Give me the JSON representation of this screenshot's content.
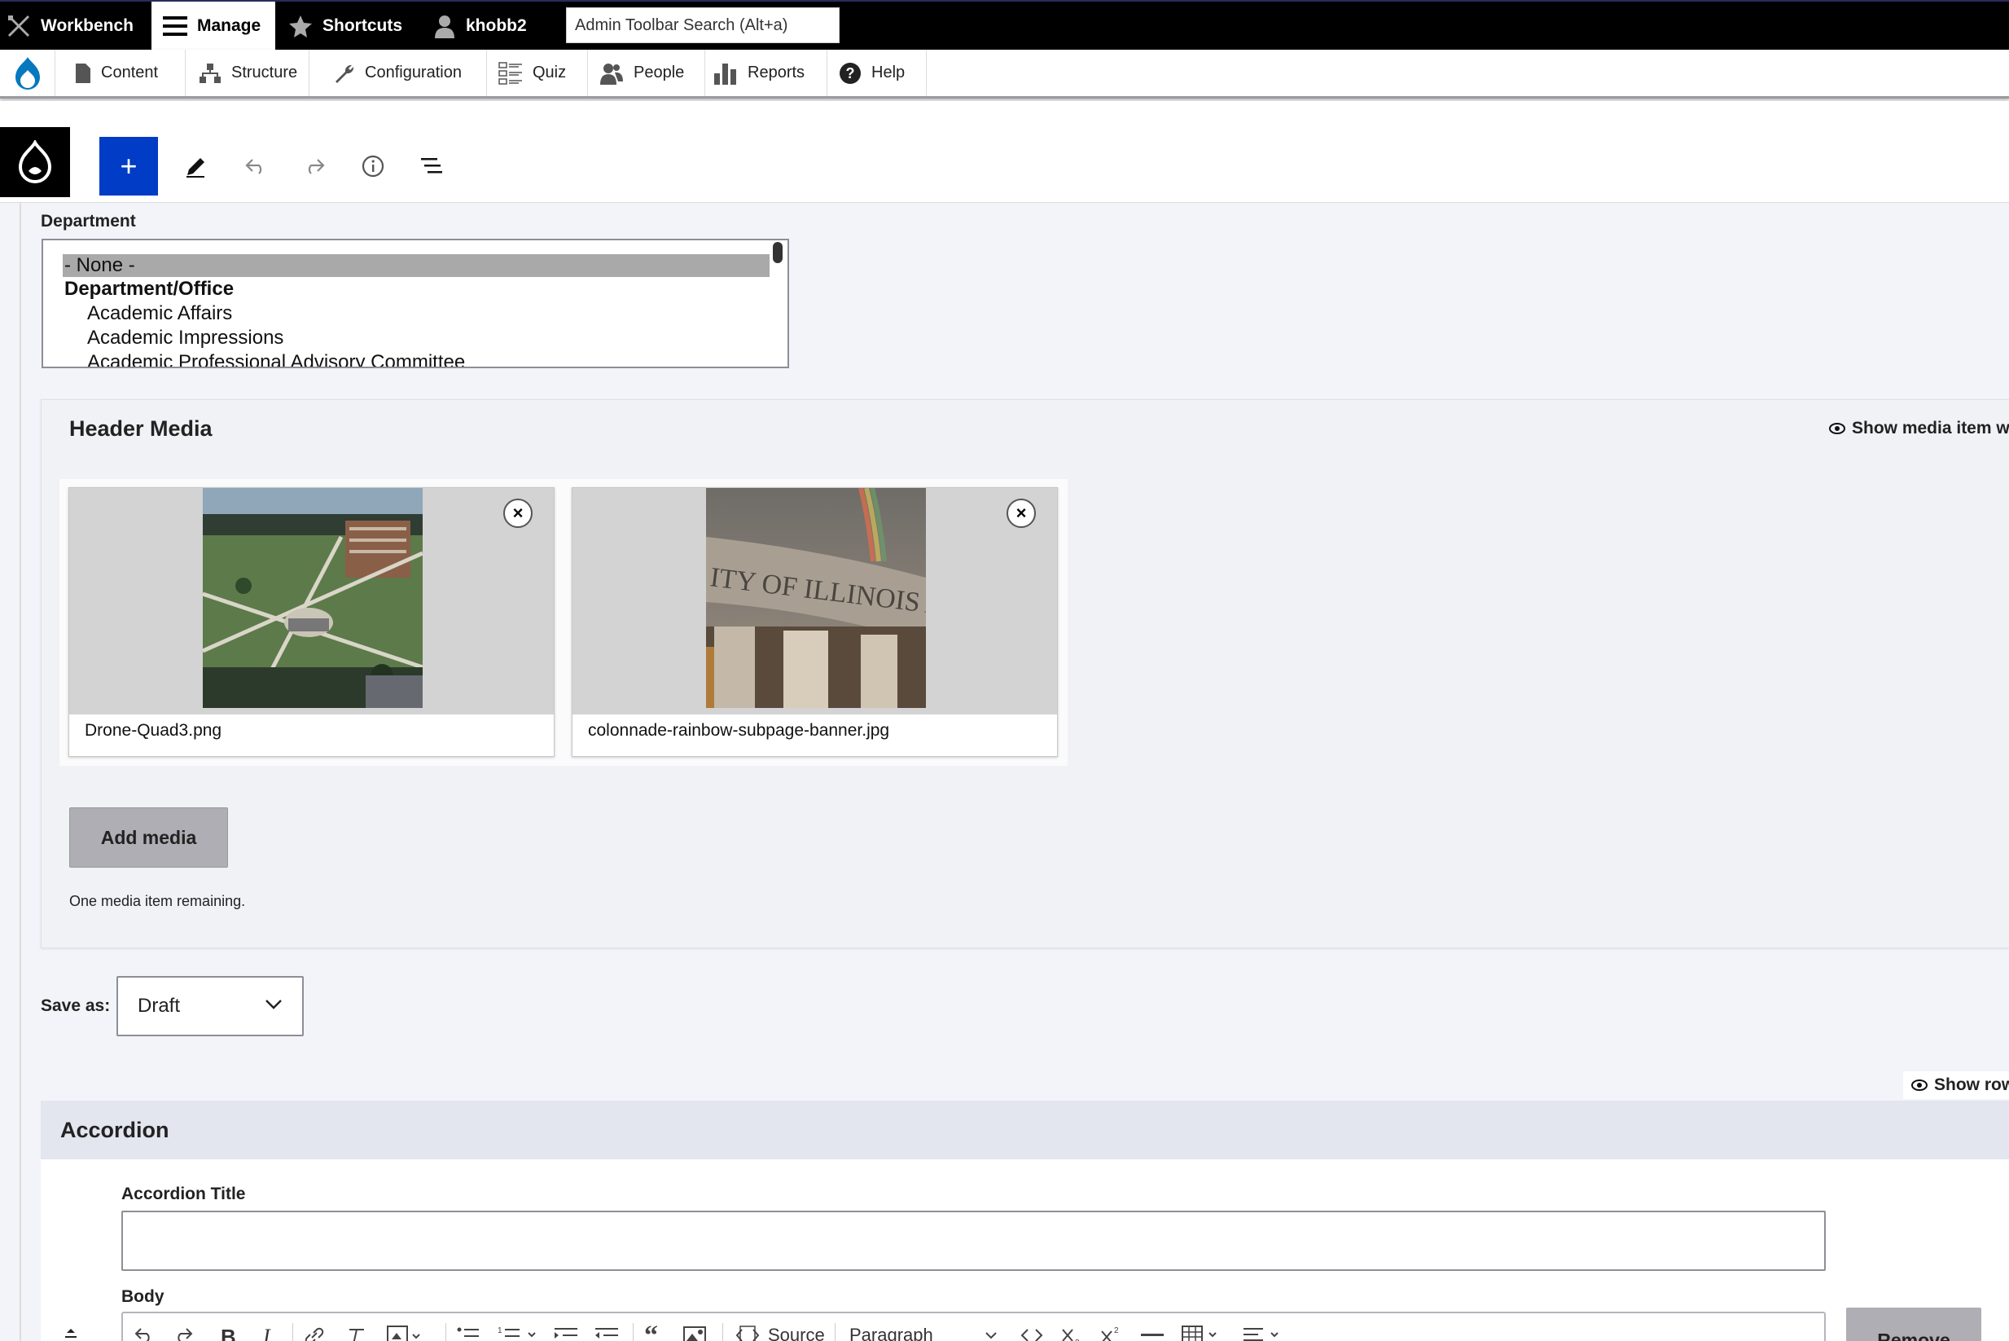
{
  "topbar": {
    "workbench": "Workbench",
    "manage": "Manage",
    "shortcuts": "Shortcuts",
    "user": "khobb2",
    "search_placeholder": "Admin Toolbar Search (Alt+a)"
  },
  "subnav": {
    "content": "Content",
    "structure": "Structure",
    "configuration": "Configuration",
    "quiz": "Quiz",
    "people": "People",
    "reports": "Reports",
    "help": "Help"
  },
  "editor_toolbar": {
    "add_symbol": "+"
  },
  "department": {
    "label": "Department",
    "options": [
      {
        "text": "- None -",
        "selected": true
      },
      {
        "text": "Department/Office",
        "group": true
      },
      {
        "text": "Academic Affairs"
      },
      {
        "text": "Academic Impressions"
      },
      {
        "text": "Academic Professional Advisory Committee"
      }
    ]
  },
  "header_media": {
    "title": "Header Media",
    "show_weights": "Show media item w",
    "items": [
      {
        "filename": "Drone-Quad3.png"
      },
      {
        "filename": "colonnade-rainbow-subpage-banner.jpg",
        "overlay_text": "ITY OF ILLINOIS AT"
      }
    ],
    "remove_symbol": "×",
    "add_media": "Add media",
    "remaining": "One media item remaining."
  },
  "save_as": {
    "label": "Save as:",
    "value": "Draft"
  },
  "show_row": "Show row",
  "accordion": {
    "title": "Accordion",
    "title_label": "Accordion Title",
    "title_value": "",
    "body_label": "Body",
    "toolbar": {
      "bold": "B",
      "italic": "I",
      "source": "Source",
      "paragraph": "Paragraph"
    },
    "remove": "Remove"
  },
  "colors": {
    "accent": "#003cc5",
    "toolbar_bg": "#000000",
    "panel_bg": "#f1f2f6"
  }
}
